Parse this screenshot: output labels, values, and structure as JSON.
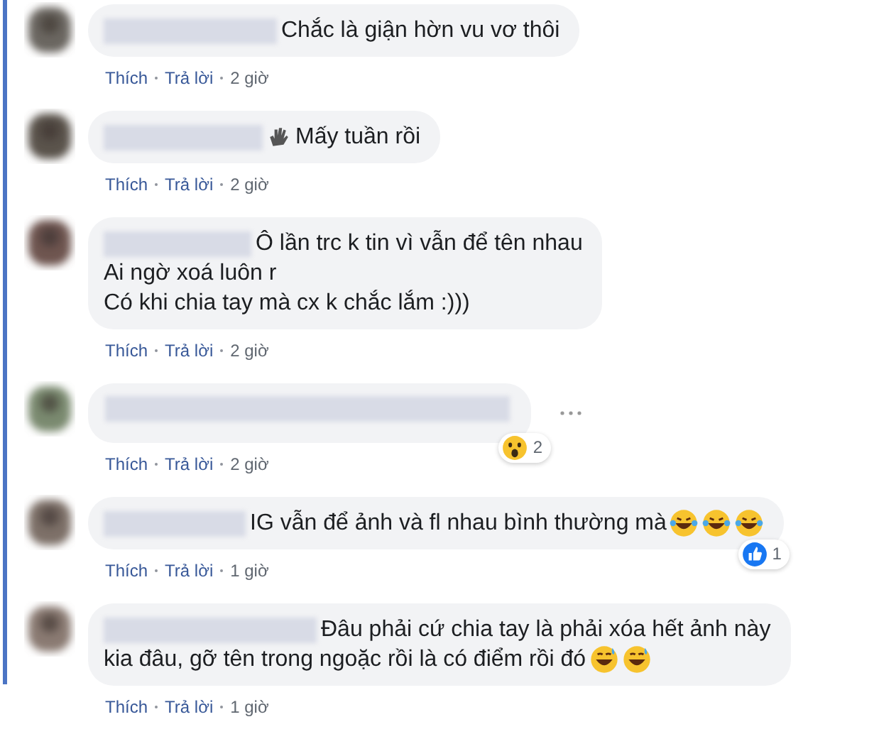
{
  "comments": [
    {
      "lines": [
        "Chắc là giận hờn vu vơ thôi"
      ],
      "actions": {
        "like": "Thích",
        "reply": "Trả lời",
        "time": "2 giờ"
      }
    },
    {
      "lines": [
        "Mấy tuần rồi"
      ],
      "lead_icon": {
        "kind": "hand"
      },
      "actions": {
        "like": "Thích",
        "reply": "Trả lời",
        "time": "2 giờ"
      }
    },
    {
      "lines": [
        "Ô lần trc k tin vì vẫn để tên nhau",
        "Ai ngờ xoá luôn r",
        "Có khi chia tay mà cx k chắc lắm :)))"
      ],
      "actions": {
        "like": "Thích",
        "reply": "Trả lời",
        "time": "2 giờ"
      }
    },
    {
      "actions": {
        "like": "Thích",
        "reply": "Trả lời",
        "time": "2 giờ"
      },
      "reaction": {
        "kind": "wow",
        "count": "2"
      },
      "menu": true
    },
    {
      "lines": [
        "IG vẫn để ảnh và fl nhau bình thường mà"
      ],
      "emojis": [
        {
          "kind": "laugh"
        },
        {
          "kind": "laugh"
        },
        {
          "kind": "laugh"
        }
      ],
      "actions": {
        "like": "Thích",
        "reply": "Trả lời",
        "time": "1 giờ"
      },
      "reaction": {
        "kind": "like",
        "count": "1"
      }
    },
    {
      "lines": [
        "Đâu phải cứ chia tay là phải xóa hết ảnh này",
        "kia đâu, gỡ tên trong ngoặc rồi là có điểm rồi đó"
      ],
      "emojis": [
        {
          "kind": "sweat"
        },
        {
          "kind": "sweat"
        }
      ],
      "actions": {
        "like": "Thích",
        "reply": "Trả lời",
        "time": "1 giờ"
      }
    }
  ]
}
